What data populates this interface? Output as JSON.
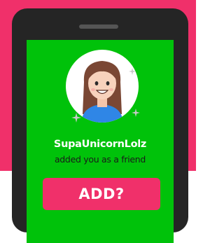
{
  "notification": {
    "username": "SupaUnicornLolz",
    "message": "added you as a friend",
    "add_button_label": "ADD?"
  },
  "colors": {
    "background_band": "#f0306a",
    "phone_body": "#252525",
    "screen": "#00c20a",
    "button": "#f0306a"
  },
  "icons": {
    "avatar": "girl-avatar-icon",
    "sparkles": "sparkle-icon"
  }
}
